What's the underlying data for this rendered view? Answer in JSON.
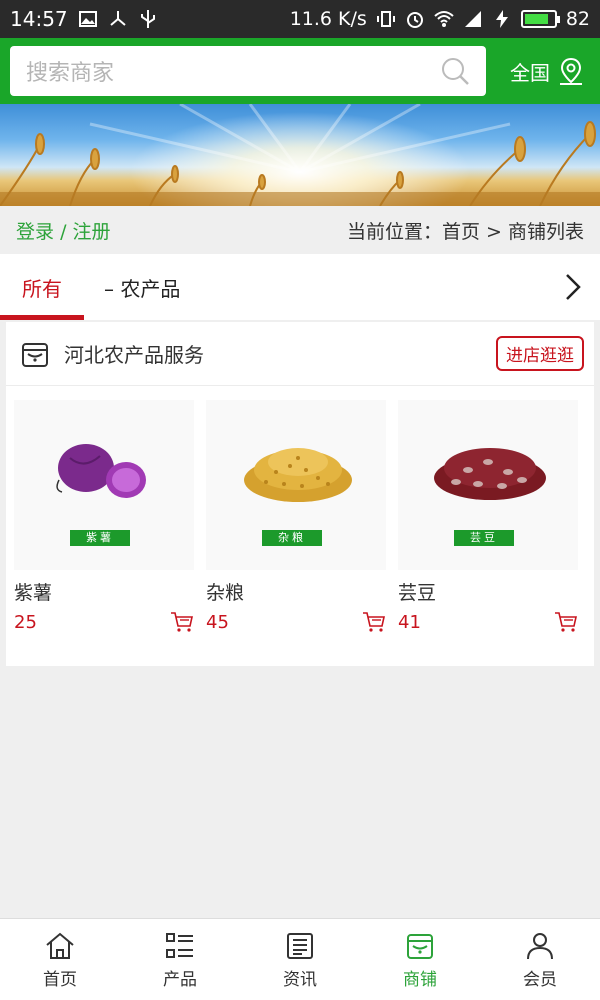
{
  "status_bar": {
    "time": "14:57",
    "speed": "11.6 K/s",
    "battery": "82",
    "battery_level": 0.82
  },
  "header": {
    "search_placeholder": "搜索商家",
    "region_label": "全国"
  },
  "breadcrumb": {
    "login": "登录",
    "separator": "/",
    "register": "注册",
    "location": "当前位置：首页 > 商铺列表"
  },
  "tabs": [
    {
      "label": "所有",
      "active": true
    },
    {
      "label": "– 农产品",
      "active": false
    }
  ],
  "shop": {
    "name": "河北农产品服务",
    "visit_label": "进店逛逛",
    "products": [
      {
        "name": "紫薯",
        "price": "25",
        "tag": "紫薯",
        "icon": "purple-sweet-potato-image"
      },
      {
        "name": "杂粮",
        "price": "45",
        "tag": "杂粮",
        "icon": "grain-pile-image"
      },
      {
        "name": "芸豆",
        "price": "41",
        "tag": "芸豆",
        "icon": "kidney-beans-image"
      }
    ]
  },
  "bottom_nav": [
    {
      "label": "首页",
      "icon": "home-icon",
      "active": false
    },
    {
      "label": "产品",
      "icon": "list-icon",
      "active": false
    },
    {
      "label": "资讯",
      "icon": "news-icon",
      "active": false
    },
    {
      "label": "商铺",
      "icon": "shop-icon",
      "active": true
    },
    {
      "label": "会员",
      "icon": "user-icon",
      "active": false
    }
  ],
  "colors": {
    "brand_green": "#1aa629",
    "accent_red": "#c8141e",
    "active_nav_green": "#2da33a"
  }
}
